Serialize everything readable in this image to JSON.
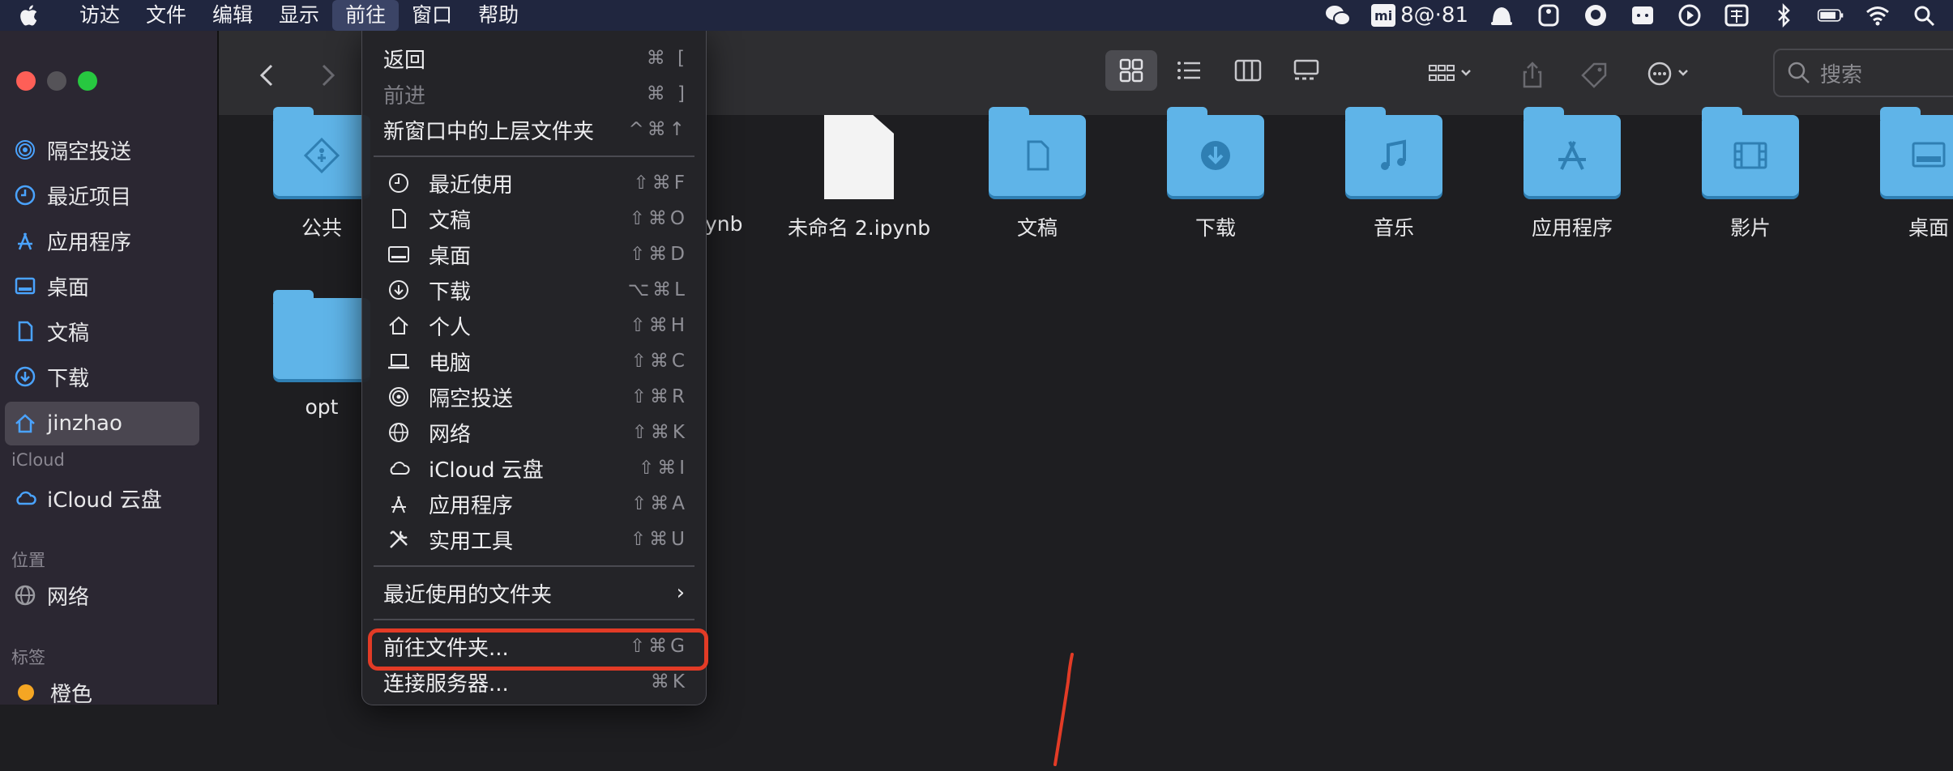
{
  "menubar": {
    "items": [
      "访达",
      "文件",
      "编辑",
      "显示",
      "前往",
      "窗口",
      "帮助"
    ],
    "active_index": 4,
    "status_text": "8@·81"
  },
  "sidebar": {
    "items": [
      {
        "label": "隔空投送",
        "icon": "airdrop-icon"
      },
      {
        "label": "最近项目",
        "icon": "clock-icon"
      },
      {
        "label": "应用程序",
        "icon": "apps-icon"
      },
      {
        "label": "桌面",
        "icon": "desktop-icon"
      },
      {
        "label": "文稿",
        "icon": "document-icon"
      },
      {
        "label": "下载",
        "icon": "download-icon"
      },
      {
        "label": "jinzhao",
        "icon": "home-icon"
      }
    ],
    "icloud_heading": "iCloud",
    "icloud_item": "iCloud 云盘",
    "location_heading": "位置",
    "network_item": "网络",
    "tags_heading": "标签",
    "tag_orange": "橙色"
  },
  "toolbar": {
    "search_placeholder": "搜索"
  },
  "files": {
    "row1": [
      "公共",
      "ynb",
      "未命名 2.ipynb",
      "文稿",
      "下载",
      "音乐",
      "应用程序",
      "影片",
      "桌面"
    ],
    "row2": [
      "opt"
    ]
  },
  "go_menu": {
    "back": {
      "label": "返回",
      "shortcut": "⌘ ["
    },
    "forward": {
      "label": "前进",
      "shortcut": "⌘ ]"
    },
    "enclosing": {
      "label": "新窗口中的上层文件夹",
      "shortcut": "^⌘↑"
    },
    "places": [
      {
        "label": "最近使用",
        "shortcut": "⇧⌘F",
        "icon": "clock-icon"
      },
      {
        "label": "文稿",
        "shortcut": "⇧⌘O",
        "icon": "document-icon"
      },
      {
        "label": "桌面",
        "shortcut": "⇧⌘D",
        "icon": "desktop-icon"
      },
      {
        "label": "下载",
        "shortcut": "⌥⌘L",
        "icon": "download-icon"
      },
      {
        "label": "个人",
        "shortcut": "⇧⌘H",
        "icon": "home-icon"
      },
      {
        "label": "电脑",
        "shortcut": "⇧⌘C",
        "icon": "laptop-icon"
      },
      {
        "label": "隔空投送",
        "shortcut": "⇧⌘R",
        "icon": "airdrop-icon"
      },
      {
        "label": "网络",
        "shortcut": "⇧⌘K",
        "icon": "globe-icon"
      },
      {
        "label": "iCloud 云盘",
        "shortcut": "⇧⌘I",
        "icon": "cloud-icon"
      },
      {
        "label": "应用程序",
        "shortcut": "⇧⌘A",
        "icon": "apps-icon"
      },
      {
        "label": "实用工具",
        "shortcut": "⇧⌘U",
        "icon": "tools-icon"
      }
    ],
    "recent_folders": "最近使用的文件夹",
    "goto_folder": {
      "label": "前往文件夹...",
      "shortcut": "⇧⌘G"
    },
    "connect_server": {
      "label": "连接服务器...",
      "shortcut": "⌘K"
    }
  },
  "colors": {
    "menubar_bg": "#20263f",
    "folder_blue": "#5fb4e8",
    "highlight_red": "#e23b26",
    "sidebar_bg": "#2b2732"
  }
}
